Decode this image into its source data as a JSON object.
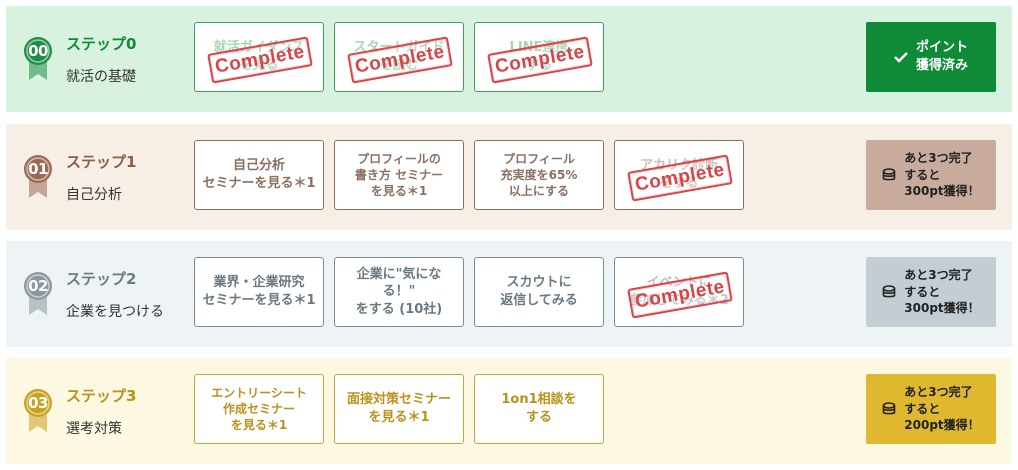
{
  "steps": [
    {
      "badge": "00",
      "title": "ステップ0",
      "subtitle": "就活の基礎",
      "title_color": "#0f8a37",
      "badge_color": "#1f8f45",
      "cards": [
        {
          "label": "就活ガイダンス\nを見る",
          "completed": true,
          "stamp": "Complete"
        },
        {
          "label": "スタートガイド\nを読む",
          "completed": true,
          "stamp": "Complete"
        },
        {
          "label": "LINE連携\nする",
          "completed": true,
          "stamp": "Complete"
        }
      ],
      "action": {
        "label": "ポイント\n獲得済み",
        "icon": "check-icon"
      }
    },
    {
      "badge": "01",
      "title": "ステップ1",
      "subtitle": "自己分析",
      "title_color": "#8b5e4a",
      "badge_color": "#9b6a55",
      "cards": [
        {
          "label": "自己分析\nセミナーを見る＊1",
          "completed": false
        },
        {
          "label": "プロフィールの\n書き方 セミナー\nを見る＊1",
          "completed": false
        },
        {
          "label": "プロフィール\n充実度を65%\n以上にする",
          "completed": false
        },
        {
          "label": "アカリク診断\nをする",
          "completed": true,
          "stamp": "Complete"
        }
      ],
      "action": {
        "label": "あと3つ完了\nすると\n300pt獲得！",
        "icon": "coin-stack-icon"
      }
    },
    {
      "badge": "02",
      "title": "ステップ2",
      "subtitle": "企業を見つける",
      "title_color": "#6b7a85",
      "badge_color": "#8a98a3",
      "cards": [
        {
          "label": "業界・企業研究\nセミナーを見る＊1",
          "completed": false
        },
        {
          "label": "企業に\"気になる！\"\nをする (10社)",
          "completed": false
        },
        {
          "label": "スカウトに\n返信してみる",
          "completed": false
        },
        {
          "label": "イベントに\n参加してみる＊2",
          "completed": true,
          "stamp": "Complete"
        }
      ],
      "action": {
        "label": "あと3つ完了\nすると\n300pt獲得！",
        "icon": "coin-stack-icon"
      }
    },
    {
      "badge": "03",
      "title": "ステップ3",
      "subtitle": "選考対策",
      "title_color": "#b8921c",
      "badge_color": "#c9a11f",
      "cards": [
        {
          "label": "エントリーシート\n作成セミナー\nを見る＊1",
          "completed": false
        },
        {
          "label": "面接対策セミナー\nを見る＊1",
          "completed": false
        },
        {
          "label": "1on1相談を\nする",
          "completed": false
        }
      ],
      "action": {
        "label": "あと3つ完了\nすると\n200pt獲得！",
        "icon": "coin-stack-icon"
      }
    }
  ]
}
